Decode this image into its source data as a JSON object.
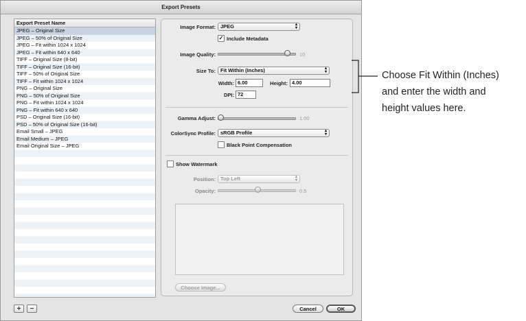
{
  "window": {
    "title": "Export Presets"
  },
  "list": {
    "header": "Export Preset Name",
    "items": [
      "JPEG – Original Size",
      "JPEG – 50% of Original Size",
      "JPEG – Fit within 1024 x 1024",
      "JPEG – Fit within 640 x 640",
      "TIFF – Original Size (8-bit)",
      "TIFF – Original Size (16-bit)",
      "TIFF – 50% of Original Size",
      "TIFF – Fit within 1024 x 1024",
      "PNG – Original Size",
      "PNG – 50% of Original Size",
      "PNG – Fit within 1024 x 1024",
      "PNG – Fit within 640 x 640",
      "PSD – Original Size (16-bit)",
      "PSD – 50% of Original Size (16-bit)",
      "Email Small – JPEG",
      "Email Medium – JPEG",
      "Email Original Size – JPEG"
    ],
    "selected_index": 0,
    "add_label": "+",
    "remove_label": "−"
  },
  "form": {
    "image_format": {
      "label": "Image Format:",
      "value": "JPEG"
    },
    "include_metadata": {
      "label": "Include Metadata",
      "checked": true
    },
    "image_quality": {
      "label": "Image Quality:",
      "value": "10",
      "level": 0.9
    },
    "size_to": {
      "label": "Size To:",
      "value": "Fit Within (Inches)"
    },
    "width": {
      "label": "Width:",
      "value": "6.00"
    },
    "height": {
      "label": "Height:",
      "value": "4.00"
    },
    "dpi": {
      "label": "DPI:",
      "value": "72"
    },
    "gamma_adjust": {
      "label": "Gamma Adjust:",
      "value": "1.00",
      "level": 0.0
    },
    "colorsync_profile": {
      "label": "ColorSync Profile:",
      "value": "sRGB Profile"
    },
    "black_point": {
      "label": "Black Point Compensation",
      "checked": false
    },
    "show_watermark": {
      "label": "Show Watermark",
      "checked": false
    },
    "position": {
      "label": "Position:",
      "value": "Top Left"
    },
    "opacity": {
      "label": "Opacity:",
      "value": "0.5",
      "level": 0.5
    },
    "choose_image_label": "Choose Image..."
  },
  "buttons": {
    "cancel": "Cancel",
    "ok": "OK"
  },
  "annotation": {
    "line1": "Choose Fit Within (Inches)",
    "line2": "and enter the width and",
    "line3": "height values here."
  },
  "colors": {
    "selection": "#c9d4e2",
    "stripe": "#edf2f7"
  },
  "icons": {
    "checkmark": "check-icon",
    "popup_arrows": "updown-arrows-icon"
  }
}
